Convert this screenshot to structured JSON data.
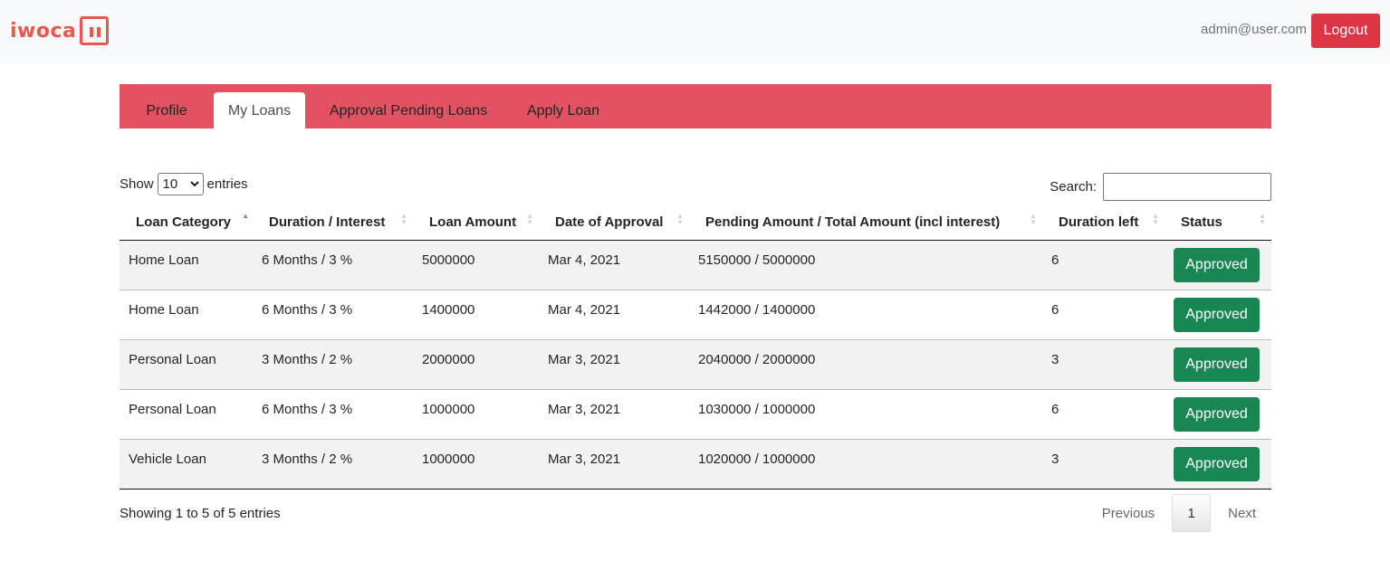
{
  "navbar": {
    "brand": "iwoca",
    "user_email": "admin@user.com",
    "logout_label": "Logout"
  },
  "tabs": [
    {
      "label": "Profile",
      "active": false
    },
    {
      "label": "My Loans",
      "active": true
    },
    {
      "label": "Approval Pending Loans",
      "active": false
    },
    {
      "label": "Apply Loan",
      "active": false
    }
  ],
  "table_controls": {
    "show_label": "Show",
    "entries_label": "entries",
    "page_length": "10",
    "search_label": "Search:",
    "search_value": ""
  },
  "table": {
    "columns": [
      {
        "label": "Loan Category",
        "sorted": "asc"
      },
      {
        "label": "Duration / Interest",
        "sorted": "none"
      },
      {
        "label": "Loan Amount",
        "sorted": "none"
      },
      {
        "label": "Date of Approval",
        "sorted": "none"
      },
      {
        "label": "Pending Amount / Total Amount (incl interest)",
        "sorted": "none"
      },
      {
        "label": "Duration left",
        "sorted": "none"
      },
      {
        "label": "Status",
        "sorted": "none"
      }
    ],
    "rows": [
      [
        "Home Loan",
        "6 Months / 3 %",
        "5000000",
        "Mar 4, 2021",
        "5150000 / 5000000",
        "6",
        "Approved"
      ],
      [
        "Home Loan",
        "6 Months / 3 %",
        "1400000",
        "Mar 4, 2021",
        "1442000 / 1400000",
        "6",
        "Approved"
      ],
      [
        "Personal Loan",
        "3 Months / 2 %",
        "2000000",
        "Mar 3, 2021",
        "2040000 / 2000000",
        "3",
        "Approved"
      ],
      [
        "Personal Loan",
        "6 Months / 3 %",
        "1000000",
        "Mar 3, 2021",
        "1030000 / 1000000",
        "6",
        "Approved"
      ],
      [
        "Vehicle Loan",
        "3 Months / 2 %",
        "1000000",
        "Mar 3, 2021",
        "1020000 / 1000000",
        "3",
        "Approved"
      ]
    ]
  },
  "footer": {
    "info": "Showing 1 to 5 of 5 entries",
    "previous_label": "Previous",
    "current_page": "1",
    "next_label": "Next"
  },
  "colors": {
    "brand": "#e8584f",
    "tabbar": "#e35261",
    "logout": "#dc3545",
    "status_approved": "#198754"
  }
}
